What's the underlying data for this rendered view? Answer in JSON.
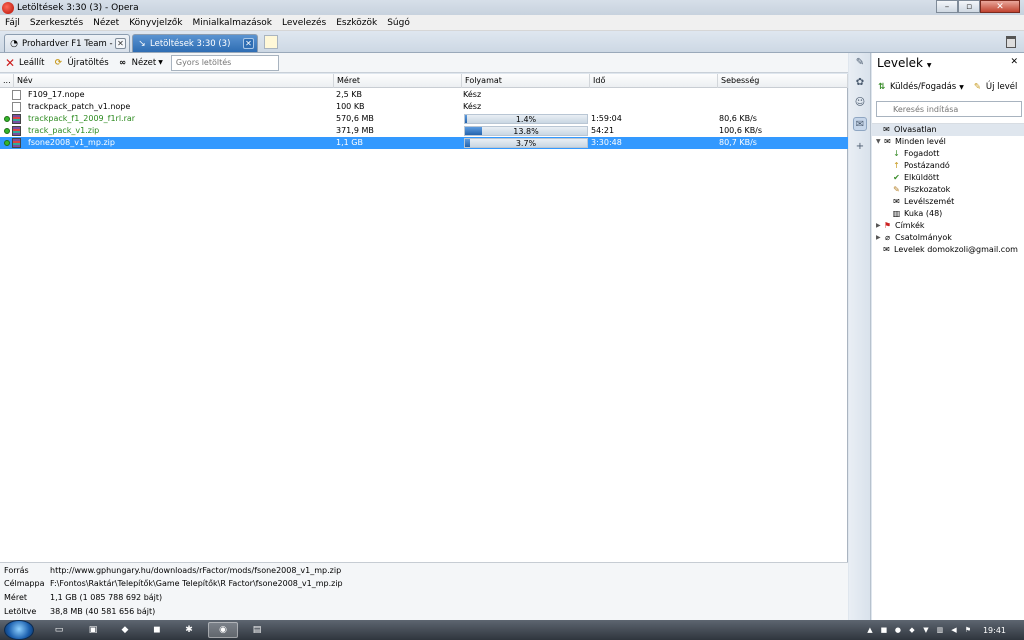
{
  "window": {
    "title": "Letöltések 3:30 (3) - Opera",
    "minimize_glyph": "–",
    "maximize_glyph": "▫",
    "close_glyph": "✕"
  },
  "menu": [
    "Fájl",
    "Szerkesztés",
    "Nézet",
    "Könyvjelzők",
    "Minialkalmazások",
    "Levelezés",
    "Eszközök",
    "Súgó"
  ],
  "tabs": [
    {
      "label": "Prohardver F1 Team - ...",
      "icon": "page-icon",
      "active": false
    },
    {
      "label": "Letöltések 3:30 (3)",
      "icon": "download-icon",
      "active": true
    }
  ],
  "toolbar": {
    "stop_label": "Leállít",
    "restart_label": "Újratöltés",
    "view_label": "Nézet",
    "quicksearch_placeholder": "Gyors letöltés"
  },
  "columns": {
    "dots": "...",
    "name": "Név",
    "size": "Méret",
    "progress": "Folyamat",
    "time": "Idő",
    "speed": "Sebesség"
  },
  "downloads": [
    {
      "name": "F109_17.nope",
      "size": "2,5 KB",
      "progress_text": "Kész",
      "progress": null,
      "time": "",
      "speed": "",
      "active": false,
      "selected": false,
      "icon": "file-icon"
    },
    {
      "name": "trackpack_patch_v1.nope",
      "size": "100 KB",
      "progress_text": "Kész",
      "progress": null,
      "time": "",
      "speed": "",
      "active": false,
      "selected": false,
      "icon": "file-icon"
    },
    {
      "name": "trackpack_f1_2009_f1rl.rar",
      "size": "570,6 MB",
      "progress_text": "1.4%",
      "progress": 0.014,
      "time": "1:59:04",
      "speed": "80,6 KB/s",
      "active": true,
      "selected": false,
      "icon": "archive-icon"
    },
    {
      "name": "track_pack_v1.zip",
      "size": "371,9 MB",
      "progress_text": "13.8%",
      "progress": 0.138,
      "time": "54:21",
      "speed": "100,6 KB/s",
      "active": true,
      "selected": false,
      "icon": "archive-icon"
    },
    {
      "name": "fsone2008_v1_mp.zip",
      "size": "1,1 GB",
      "progress_text": "3.7%",
      "progress": 0.037,
      "time": "3:30:48",
      "speed": "80,7 KB/s",
      "active": true,
      "selected": true,
      "icon": "archive-icon"
    }
  ],
  "details": {
    "source_label": "Forrás",
    "source_value": "http://www.gphungary.hu/downloads/rFactor/mods/fsone2008_v1_mp.zip",
    "target_label": "Célmappa",
    "target_value": "F:\\Fontos\\Raktár\\Telepítők\\Game Telepítők\\R Factor\\fsone2008_v1_mp.zip",
    "size_label": "Méret",
    "size_value": "1,1 GB (1 085 788 692 bájt)",
    "downloaded_label": "Letöltve",
    "downloaded_value": "38,8 MB (40 581 656 bájt)"
  },
  "mail": {
    "title": "Levelek",
    "close_glyph": "✕",
    "send_receive_label": "Küldés/Fogadás",
    "new_mail_label": "Új levél",
    "search_placeholder": "Keresés indítása",
    "tree": {
      "unread": "Olvasatlan",
      "all_mail": "Minden levél",
      "received": "Fogadott",
      "outbox": "Postázandó",
      "sent": "Elküldött",
      "drafts": "Piszkozatok",
      "spam": "Levélszemét",
      "trash": "Kuka (48)",
      "labels": "Címkék",
      "attachments": "Csatolmányok",
      "account": "Levelek domokzoli@gmail.com"
    }
  },
  "taskbar": {
    "clock": "19:41"
  },
  "colors": {
    "selection": "#3399ff",
    "active_text": "#2b8a1e",
    "progress_fill": "#2463ad"
  }
}
